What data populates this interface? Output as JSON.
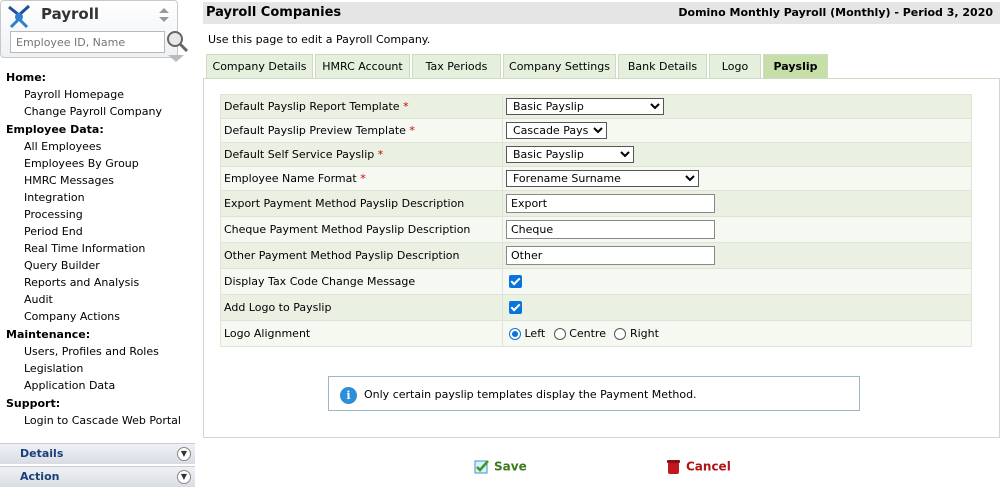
{
  "app": {
    "title": "Payroll",
    "search_placeholder": "Employee ID, Name"
  },
  "nav": [
    {
      "heading": "Home:",
      "items": [
        "Payroll Homepage",
        "Change Payroll Company"
      ]
    },
    {
      "heading": "Employee Data:",
      "items": [
        "All Employees",
        "Employees By Group",
        "HMRC Messages",
        "Integration",
        "Processing",
        "Period End",
        "Real Time Information",
        "Query Builder",
        "Reports and Analysis",
        "Audit",
        "Company Actions"
      ]
    },
    {
      "heading": "Maintenance:",
      "items": [
        "Users, Profiles and Roles",
        "Legislation",
        "Application Data"
      ]
    },
    {
      "heading": "Support:",
      "items": [
        "Login to Cascade Web Portal"
      ]
    }
  ],
  "side_panels": {
    "details": "Details",
    "action": "Action"
  },
  "header": {
    "title": "Payroll Companies",
    "context": "Domino Monthly Payroll (Monthly) - Period 3, 2020"
  },
  "intro": "Use this page to edit a Payroll Company.",
  "tabs": [
    "Company Details",
    "HMRC Account",
    "Tax Periods",
    "Company Settings",
    "Bank Details",
    "Logo",
    "Payslip"
  ],
  "active_tab": "Payslip",
  "form": {
    "report_template": {
      "label": "Default Payslip Report Template",
      "value": "Basic Payslip"
    },
    "preview_template": {
      "label": "Default Payslip Preview Template",
      "value": "Cascade Payslip"
    },
    "self_service": {
      "label": "Default Self Service Payslip",
      "value": "Basic Payslip"
    },
    "name_format": {
      "label": "Employee Name Format",
      "value": "Forename Surname"
    },
    "export_desc": {
      "label": "Export Payment Method Payslip Description",
      "value": "Export"
    },
    "cheque_desc": {
      "label": "Cheque Payment Method Payslip Description",
      "value": "Cheque"
    },
    "other_desc": {
      "label": "Other Payment Method Payslip Description",
      "value": "Other"
    },
    "tax_code_msg": {
      "label": "Display Tax Code Change Message",
      "checked": true
    },
    "add_logo": {
      "label": "Add Logo to Payslip",
      "checked": true
    },
    "logo_alignment": {
      "label": "Logo Alignment",
      "options": [
        "Left",
        "Centre",
        "Right"
      ],
      "selected": "Left"
    },
    "required_mark": "*"
  },
  "info": "Only certain payslip templates display the Payment Method.",
  "buttons": {
    "save": "Save",
    "cancel": "Cancel"
  },
  "colors": {
    "tab_active": "#c6dfa9",
    "tab": "#e4efdc",
    "accent_blue": "#1c3f7a",
    "save_green": "#3a7a1c",
    "cancel_red": "#b01515"
  }
}
